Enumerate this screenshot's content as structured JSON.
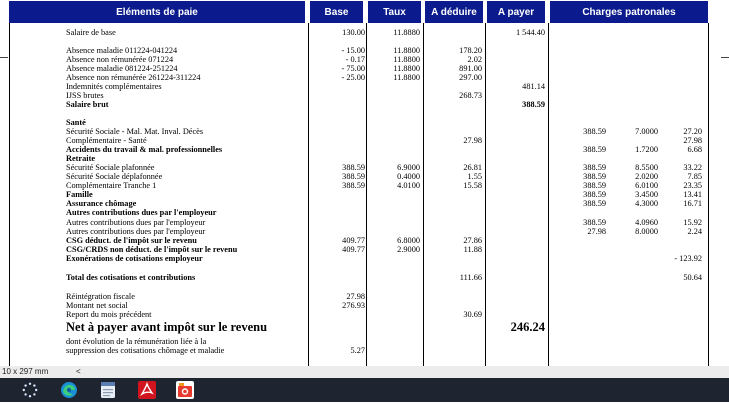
{
  "header": {
    "elements": "Eléments de paie",
    "base": "Base",
    "taux": "Taux",
    "a_deduire": "A déduire",
    "a_payer": "A payer",
    "charges": "Charges patronales"
  },
  "rows": [
    {
      "label": "Salaire de base",
      "base": "130.00",
      "taux": "11.8880",
      "pay": "1 544.40"
    },
    {
      "label": "Absence maladie 011224-041224",
      "base": "- 15.00",
      "taux": "11.8800",
      "ded": "178.20"
    },
    {
      "label": "Absence non rémunérée 071224",
      "base": "- 0.17",
      "taux": "11.8800",
      "ded": "2.02"
    },
    {
      "label": "Absence maladie 081224-251224",
      "base": "- 75.00",
      "taux": "11.8800",
      "ded": "891.00"
    },
    {
      "label": "Absence non rémunérée 261224-311224",
      "base": "- 25.00",
      "taux": "11.8800",
      "ded": "297.00"
    },
    {
      "label": "Indemnités complémentaires",
      "pay": "481.14"
    },
    {
      "label": "IJSS brutes",
      "ded": "268.73"
    },
    {
      "label": "Salaire brut",
      "pay": "388.59",
      "bold": true
    },
    {
      "label": "Santé",
      "bold": true
    },
    {
      "label": "Sécurité Sociale - Mal. Mat. Inval. Décès",
      "c1": "388.59",
      "c2": "7.0000",
      "c3": "27.20"
    },
    {
      "label": "Complémentaire - Santé",
      "ded": "27.98",
      "c3": "27.98"
    },
    {
      "label": "Accidents du travail & mal. professionnelles",
      "bold": true,
      "c1": "388.59",
      "c2": "1.7200",
      "c3": "6.68"
    },
    {
      "label": "Retraite",
      "bold": true
    },
    {
      "label": "Sécurité Sociale plafonnée",
      "base": "388.59",
      "taux": "6.9000",
      "ded": "26.81",
      "c1": "388.59",
      "c2": "8.5500",
      "c3": "33.22"
    },
    {
      "label": "Sécurité Sociale déplafonnée",
      "base": "388.59",
      "taux": "0.4000",
      "ded": "1.55",
      "c1": "388.59",
      "c2": "2.0200",
      "c3": "7.85"
    },
    {
      "label": "Complémentaire Tranche 1",
      "base": "388.59",
      "taux": "4.0100",
      "ded": "15.58",
      "c1": "388.59",
      "c2": "6.0100",
      "c3": "23.35"
    },
    {
      "label": "Famille",
      "bold": true,
      "c1": "388.59",
      "c2": "3.4500",
      "c3": "13.41"
    },
    {
      "label": "Assurance chômage",
      "bold": true,
      "c1": "388.59",
      "c2": "4.3000",
      "c3": "16.71"
    },
    {
      "label": "Autres contributions dues par l'employeur",
      "bold": true
    },
    {
      "label": "Autres contributions dues par l'employeur",
      "c1": "388.59",
      "c2": "4.0960",
      "c3": "15.92"
    },
    {
      "label": "Autres contributions dues par l'employeur",
      "c1": "27.98",
      "c2": "8.0000",
      "c3": "2.24"
    },
    {
      "label": "CSG déduct. de l'impôt sur le revenu",
      "bold": true,
      "base": "409.77",
      "taux": "6.8000",
      "ded": "27.86"
    },
    {
      "label": "CSG/CRDS non déduct. de l'impôt sur le revenu",
      "bold": true,
      "base": "409.77",
      "taux": "2.9000",
      "ded": "11.88"
    },
    {
      "label": "Exonérations de cotisations employeur",
      "bold": true,
      "c3": "- 123.92"
    },
    {
      "label": "Total des cotisations et contributions",
      "bold": true,
      "ded": "111.66",
      "c3": "50.64"
    },
    {
      "label": "Réintégration fiscale",
      "base": "27.98"
    },
    {
      "label": "Montant net social",
      "base": "276.93"
    },
    {
      "label": "Report du mois précédent",
      "ded": "30.69"
    },
    {
      "label": "Net à payer avant impôt sur le revenu",
      "pay": "246.24",
      "big": true
    },
    {
      "label": "dont évolution de la rémunération liée à la"
    },
    {
      "label": "suppression des cotisations chômage et maladie",
      "base": "5.27"
    }
  ],
  "status": {
    "page_size": "10 x 297 mm",
    "arrow": "<"
  },
  "taskbar": {
    "items": [
      "start",
      "edge",
      "notes",
      "pdf-reader",
      "image-viewer"
    ]
  }
}
